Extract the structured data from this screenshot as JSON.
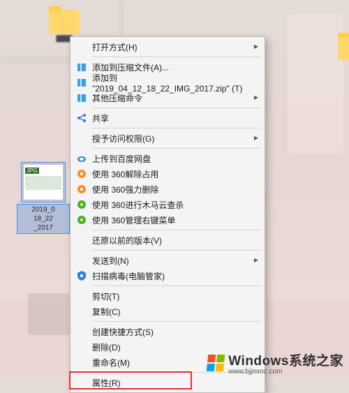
{
  "desktop": {
    "folder1_label": "▇▇▇",
    "folder2_label": "▇",
    "selected_file": {
      "badge": "JPG",
      "name_line1": "2019_0",
      "name_line2": "18_22",
      "name_line3": "_2017"
    }
  },
  "context_menu": {
    "open_with": "打开方式(H)",
    "add_to_archive": "添加到压缩文件(A)...",
    "add_to_named_zip": "添加到 \"2019_04_12_18_22_IMG_2017.zip\" (T)",
    "other_compress": "其他压缩命令",
    "share": "共享",
    "grant_access": "授予访问权限(G)",
    "upload_baidu": "上传到百度网盘",
    "360_unlock": "使用 360解除占用",
    "360_force_delete": "使用 360强力删除",
    "360_trojan_scan": "使用 360进行木马云查杀",
    "360_context_mgr": "使用 360管理右键菜单",
    "restore_prev": "还原以前的版本(V)",
    "send_to": "发送到(N)",
    "scan_virus": "扫描病毒(电脑管家)",
    "cut": "剪切(T)",
    "copy": "复制(C)",
    "create_shortcut": "创建快捷方式(S)",
    "delete": "删除(D)",
    "rename": "重命名(M)",
    "properties": "属性(R)"
  },
  "watermark": {
    "title": "Windows系统之家",
    "url": "www.bjjmmc.com"
  },
  "icons": {
    "zip": "zip-icon",
    "share": "share-icon",
    "baidu": "baidu-disk-icon",
    "360orange": "360-orange-icon",
    "360green": "360-green-icon",
    "guanjia": "tencent-guanjia-icon"
  }
}
